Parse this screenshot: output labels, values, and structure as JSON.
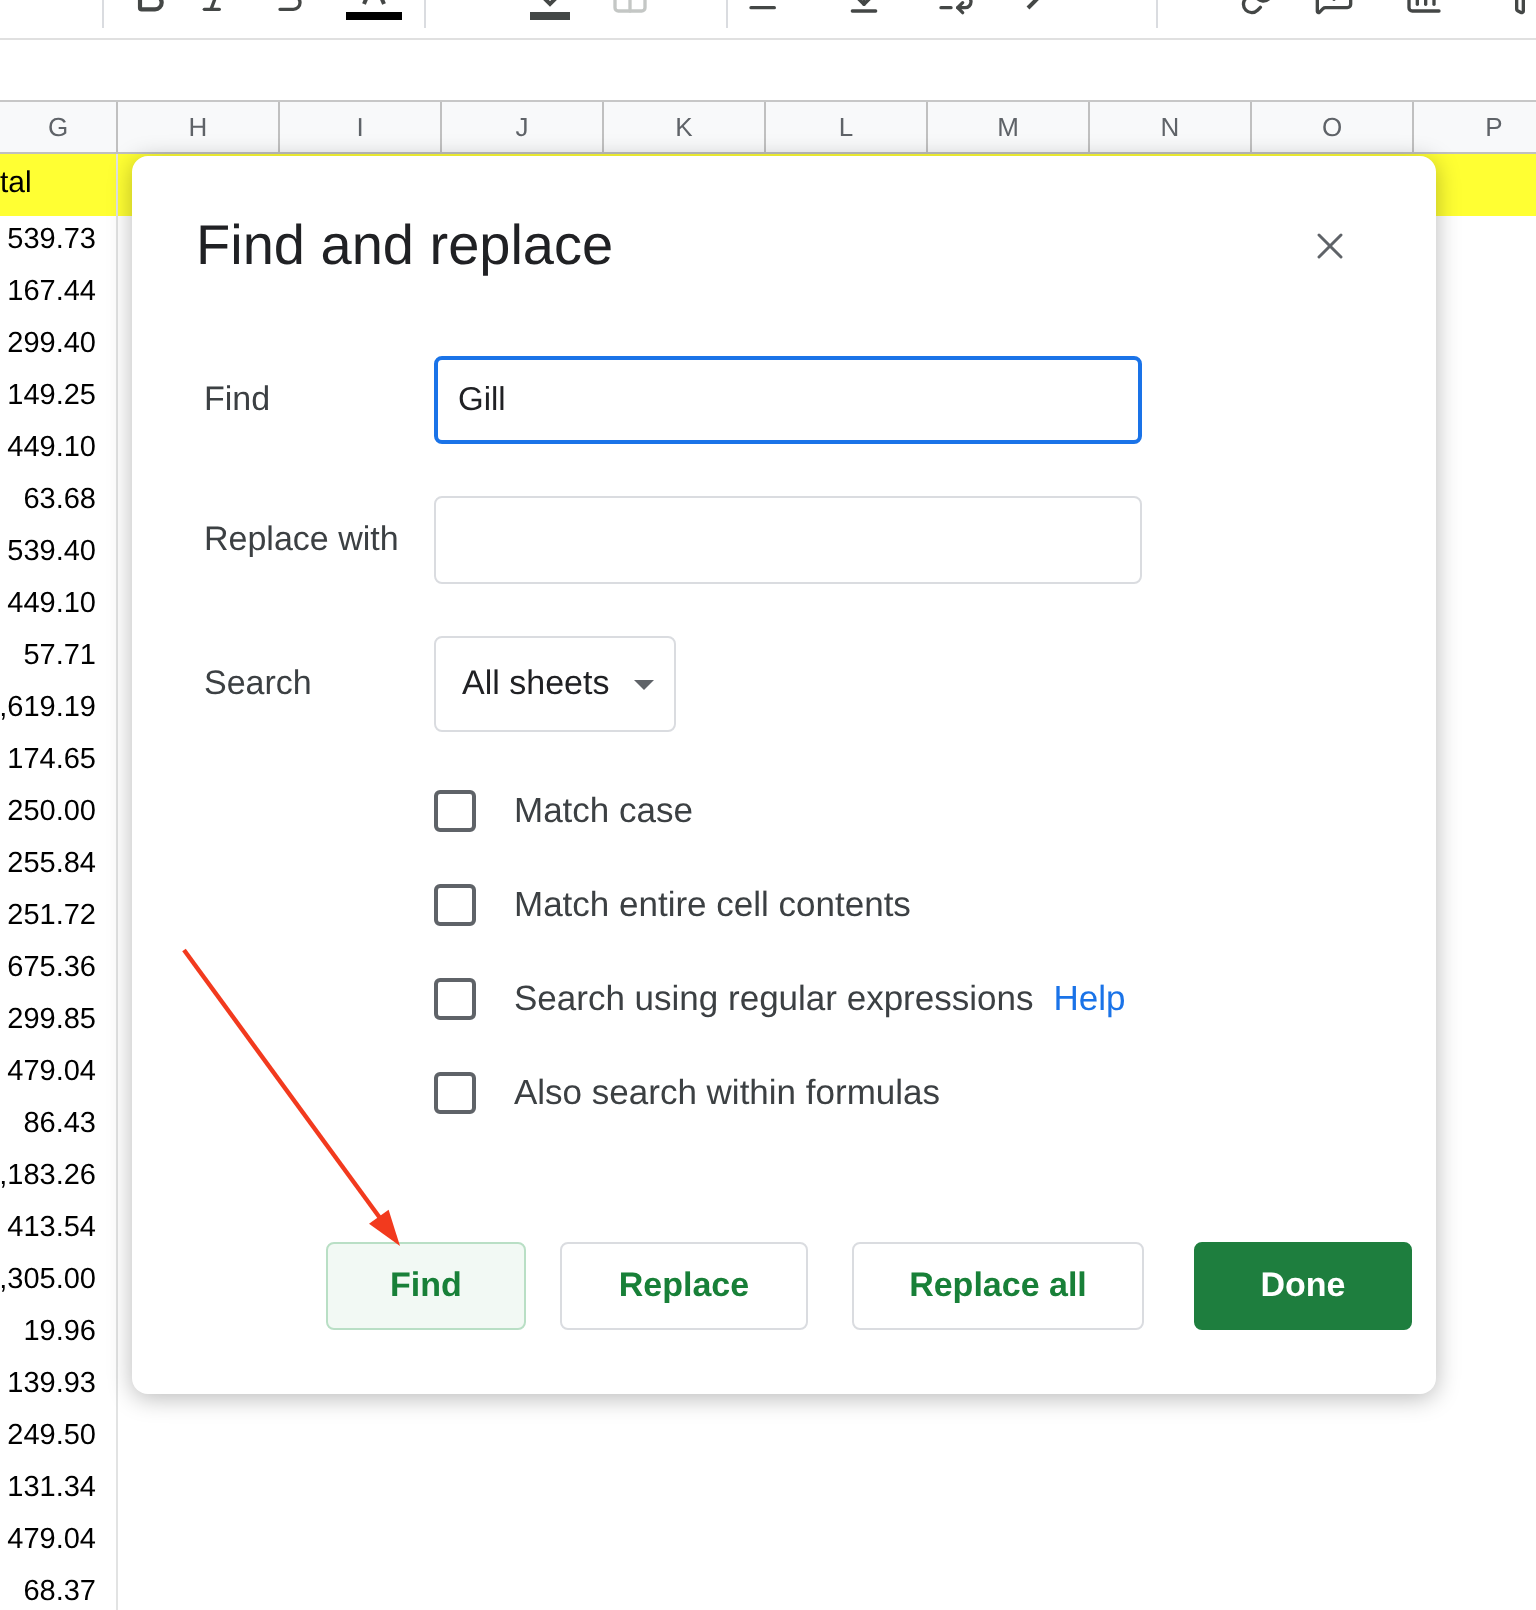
{
  "column_headers": [
    "G",
    "H",
    "I",
    "J",
    "K",
    "L",
    "M",
    "N",
    "O",
    "P"
  ],
  "sheet": {
    "highlighted_cell": "tal",
    "values": [
      "539.73",
      "167.44",
      "299.40",
      "149.25",
      "449.10",
      "63.68",
      "539.40",
      "449.10",
      "57.71",
      ",619.19",
      "174.65",
      "250.00",
      "255.84",
      "251.72",
      "675.36",
      "299.85",
      "479.04",
      "86.43",
      ",183.26",
      "413.54",
      ",305.00",
      "19.96",
      "139.93",
      "249.50",
      "131.34",
      "479.04",
      "68.37"
    ]
  },
  "dialog": {
    "title": "Find and replace",
    "fields": [
      {
        "label": "Find",
        "kind": "text",
        "value": "Gill",
        "focused": true
      },
      {
        "label": "Replace with",
        "kind": "text",
        "focused": false
      },
      {
        "label": "Search",
        "kind": "dropdown",
        "value": "All sheets"
      }
    ],
    "options": [
      {
        "label": "Match case",
        "checked": false
      },
      {
        "label": "Match entire cell contents",
        "checked": false
      },
      {
        "label": "Search using regular expressions",
        "checked": false,
        "help_link": "Help"
      },
      {
        "label": "Also search within formulas",
        "checked": false
      }
    ],
    "buttons": [
      {
        "label": "Find",
        "kind": "secondary",
        "focused": true
      },
      {
        "label": "Replace",
        "kind": "secondary",
        "focused": false
      },
      {
        "label": "Replace all",
        "kind": "secondary",
        "focused": false
      },
      {
        "label": "Done",
        "kind": "primary",
        "focused": false
      }
    ]
  }
}
